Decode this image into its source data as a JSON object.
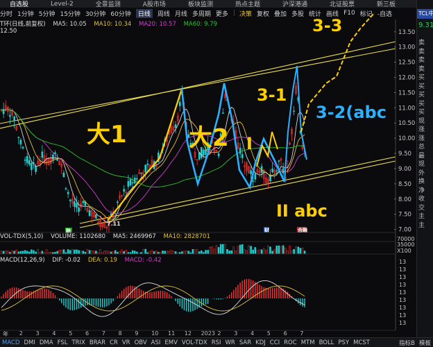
{
  "top_tabs": [
    "自选股",
    "Level-2",
    "全景监测",
    "A股市场",
    "板块监测",
    "热点主题",
    "沪深港通",
    "北证股票",
    "新三板"
  ],
  "period": {
    "items": [
      "分时",
      "1分钟",
      "5分钟",
      "15分钟",
      "30分钟",
      "60分钟",
      "日线",
      "周线",
      "月线",
      "多周期",
      "更多"
    ],
    "selected_index": 6,
    "tools": [
      "决策",
      "复权",
      "叠加",
      "多股",
      "统计",
      "画线",
      "F10",
      "标记",
      "-自选"
    ]
  },
  "main_legend": {
    "title": "T环(日线,前复权)",
    "ma5": "MA5: 10.05",
    "ma10": "MA10: 10.34",
    "ma20": "MA20: 10.57",
    "ma60": "MA60: 9.79",
    "top_value": "12.50",
    "colors": {
      "ma5": "#d8d8d8",
      "ma10": "#e0c040",
      "ma20": "#d040d0",
      "ma60": "#30c030"
    }
  },
  "price_axis": [
    "13.50",
    "13.00",
    "12.50",
    "12.00",
    "11.50",
    "11.00",
    "10.50",
    "10.00",
    "9.50",
    "9.00",
    "8.50",
    "8.00",
    "7.50",
    "7.00"
  ],
  "annotations": {
    "wave1": "大1",
    "wave2": "大2",
    "wave3_1": "3-1",
    "wave3_2": "3-2(abc",
    "wave3_3": "3-3",
    "wave_i": "I",
    "wave_ii": "II abc",
    "low_mark": "7.11",
    "marker_b": "融",
    "marker_m": "财",
    "marker_r": "合融"
  },
  "volume_legend": {
    "title": "VOL-TDX(5,10)",
    "volume": "VOLUME: 1102680",
    "ma5": "MA5: 2469967",
    "ma10": "MA10: 2828701",
    "axis": [
      "70000",
      "35000",
      "X100"
    ]
  },
  "macd_legend": {
    "title": "MACD(12,26,9)",
    "dif": "DIF: -0.02",
    "dea": "DEA: 0.19",
    "macd": "MACD: -0.42"
  },
  "months": [
    "年",
    "2",
    "3",
    "4",
    "5",
    "6",
    "7",
    "8",
    "9",
    "10",
    "11",
    "12",
    "2023",
    "2",
    "3",
    "4",
    "5",
    "6",
    "7"
  ],
  "bottom_tabs": {
    "items": [
      "MACD",
      "DMI",
      "DMA",
      "FSL",
      "TRIX",
      "BRAR",
      "CR",
      "VR",
      "OBV",
      "ASI",
      "EMV",
      "VOL-TDX",
      "RSI",
      "WR",
      "SAR",
      "KDJ",
      "CCI",
      "ROC",
      "MTM",
      "BOLL",
      "PSY",
      "MCST"
    ],
    "active_index": 0,
    "right": [
      "指标B",
      "模板"
    ]
  },
  "right_panel": {
    "code": "TCL中",
    "price": "9.31",
    "items": [
      "卖",
      "卖",
      "卖",
      "卖",
      "买",
      "买",
      "买",
      "买",
      "买",
      "现",
      "涨",
      "涨",
      "总",
      "最",
      "现",
      "外",
      "换",
      "净",
      "收",
      "交",
      "主",
      "主"
    ]
  },
  "chart_data": [
    {
      "type": "candlestick",
      "title": "T环(日线,前复权)",
      "ylim": [
        6.9,
        13.7
      ],
      "series": [
        {
          "name": "MA5",
          "value": 10.05
        },
        {
          "name": "MA10",
          "value": 10.34
        },
        {
          "name": "MA20",
          "value": 10.57
        },
        {
          "name": "MA60",
          "value": 9.79
        }
      ],
      "low": 7.11
    },
    {
      "type": "bar",
      "title": "VOL-TDX(5,10)",
      "ylim": [
        0,
        70000
      ]
    },
    {
      "type": "bar",
      "title": "MACD(12,26,9)",
      "series": [
        {
          "name": "DIF",
          "value": -0.02
        },
        {
          "name": "DEA",
          "value": 0.19
        },
        {
          "name": "MACD",
          "value": -0.42
        }
      ]
    }
  ]
}
